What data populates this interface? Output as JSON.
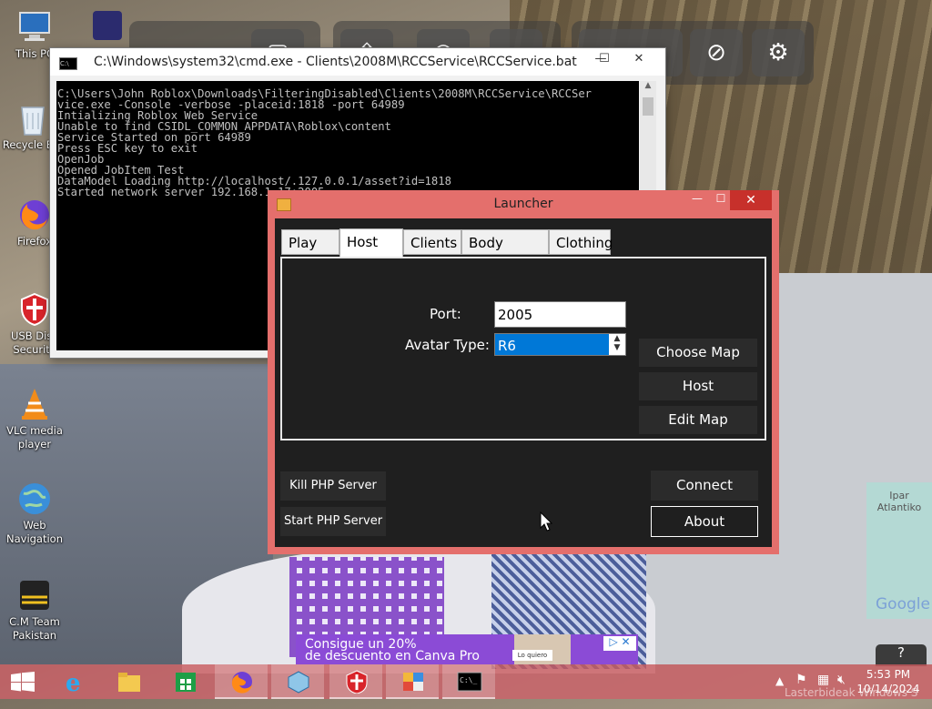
{
  "desktop": {
    "icons": [
      {
        "label": "This PC",
        "name": "this-pc-icon"
      },
      {
        "label": "Recycle Bin",
        "name": "recycle-bin-icon"
      },
      {
        "label": "Firefox",
        "name": "firefox-icon"
      },
      {
        "label": "USB Disk Security",
        "name": "usb-disk-security-icon"
      },
      {
        "label": "VLC media player",
        "name": "vlc-icon"
      },
      {
        "label": "Web Navigation",
        "name": "web-navigation-icon"
      },
      {
        "label": "C.M Team Pakistan",
        "name": "cm-team-icon"
      }
    ],
    "ad": {
      "line1": "Consigue un 20%",
      "line2": "de descuento en Canva Pro",
      "cta": "Lo quiero"
    },
    "map_label": "Ipar Atlantiko",
    "map_brand": "Google",
    "help": "?"
  },
  "cmd": {
    "title": "C:\\Windows\\system32\\cmd.exe - Clients\\2008M\\RCCService\\RCCService.bat",
    "output": "C:\\Users\\John Roblox\\Downloads\\FilteringDisabled\\Clients\\2008M\\RCCService\\RCCSer\nvice.exe -Console -verbose -placeid:1818 -port 64989\nIntializing Roblox Web Service\nUnable to find CSIDL_COMMON_APPDATA\\Roblox\\content\nService Started on port 64989\nPress ESC key to exit\nOpenJob\nOpened JobItem Test\nDataModel Loading http://localhost/.127.0.0.1/asset?id=1818\nStarted network server 192.168.1.17:2005",
    "buttons": {
      "minimize": "—",
      "maximize": "☐",
      "close": "✕"
    }
  },
  "launcher": {
    "title": "Launcher",
    "buttons": {
      "minimize": "—",
      "maximize": "☐",
      "close": "✕"
    },
    "tabs": [
      {
        "label": "Play",
        "active": false
      },
      {
        "label": "Host",
        "active": true
      },
      {
        "label": "Clients",
        "active": false
      },
      {
        "label": "Body Colors",
        "active": false
      },
      {
        "label": "Clothing",
        "active": false
      }
    ],
    "host": {
      "port_label": "Port:",
      "port_value": "2005",
      "avatar_label": "Avatar Type:",
      "avatar_value": "R6",
      "choose_map": "Choose Map",
      "host": "Host",
      "edit_map": "Edit Map"
    },
    "footer": {
      "kill_php": "Kill PHP Server",
      "start_php": "Start PHP Server",
      "connect": "Connect",
      "about": "About"
    }
  },
  "taskbar": {
    "items": [
      "start",
      "internet-explorer",
      "file-explorer",
      "store",
      "firefox",
      "app-cube",
      "usb-disk-security",
      "launcher",
      "command-prompt"
    ],
    "clock_time": "5:53 PM",
    "clock_date": "10/14/2024",
    "watermark": "Lasterbideak Windows S"
  },
  "colors": {
    "launcher_frame": "#e46f6c",
    "launcher_body": "#1f1f1f",
    "taskbar": "#c85c5f",
    "selection": "#0078d7"
  }
}
